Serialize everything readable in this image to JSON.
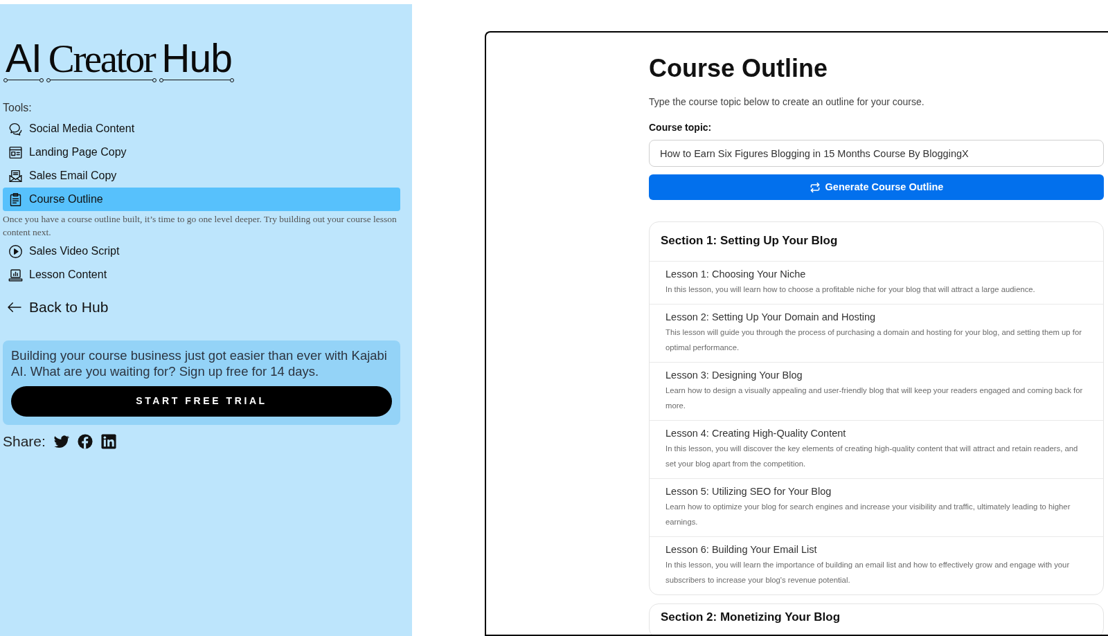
{
  "sidebar": {
    "logo": [
      "AI",
      "Creator",
      "Hub"
    ],
    "tools_label": "Tools:",
    "tools": [
      {
        "label": "Social Media Content",
        "selected": false
      },
      {
        "label": "Landing Page Copy",
        "selected": false
      },
      {
        "label": "Sales Email Copy",
        "selected": false
      },
      {
        "label": "Course Outline",
        "selected": true
      },
      {
        "label": "Sales Video Script",
        "selected": false
      },
      {
        "label": "Lesson Content",
        "selected": false
      }
    ],
    "selected_tool_hint": "Once you have a course outline built, it’s time to go one level deeper. Try building out your course lesson content next.",
    "back_link": "Back to Hub",
    "promo": {
      "text": "Building your course business just got easier than ever with Kajabi AI. What are you waiting for? Sign up free for 14 days.",
      "button": "START FREE TRIAL"
    },
    "share_label": "Share:"
  },
  "main": {
    "title": "Course Outline",
    "intro": "Type the course topic below to create an outline for your course.",
    "topic_field": {
      "label": "Course topic:",
      "value": "How to Earn Six Figures Blogging in 15 Months Course By BloggingX"
    },
    "generate_button": "Generate Course Outline",
    "sections": [
      {
        "title": "Section 1: Setting Up Your Blog",
        "lessons": [
          {
            "title": "Lesson 1: Choosing Your Niche",
            "description": "In this lesson, you will learn how to choose a profitable niche for your blog that will attract a large audience."
          },
          {
            "title": "Lesson 2: Setting Up Your Domain and Hosting",
            "description": "This lesson will guide you through the process of purchasing a domain and hosting for your blog, and setting them up for optimal performance."
          },
          {
            "title": "Lesson 3: Designing Your Blog",
            "description": "Learn how to design a visually appealing and user-friendly blog that will keep your readers engaged and coming back for more."
          },
          {
            "title": "Lesson 4: Creating High-Quality Content",
            "description": "In this lesson, you will discover the key elements of creating high-quality content that will attract and retain readers, and set your blog apart from the competition."
          },
          {
            "title": "Lesson 5: Utilizing SEO for Your Blog",
            "description": "Learn how to optimize your blog for search engines and increase your visibility and traffic, ultimately leading to higher earnings."
          },
          {
            "title": "Lesson 6: Building Your Email List",
            "description": "In this lesson, you will learn the importance of building an email list and how to effectively grow and engage with your subscribers to increase your blog's revenue potential."
          }
        ]
      },
      {
        "title": "Section 2: Monetizing Your Blog"
      }
    ]
  }
}
